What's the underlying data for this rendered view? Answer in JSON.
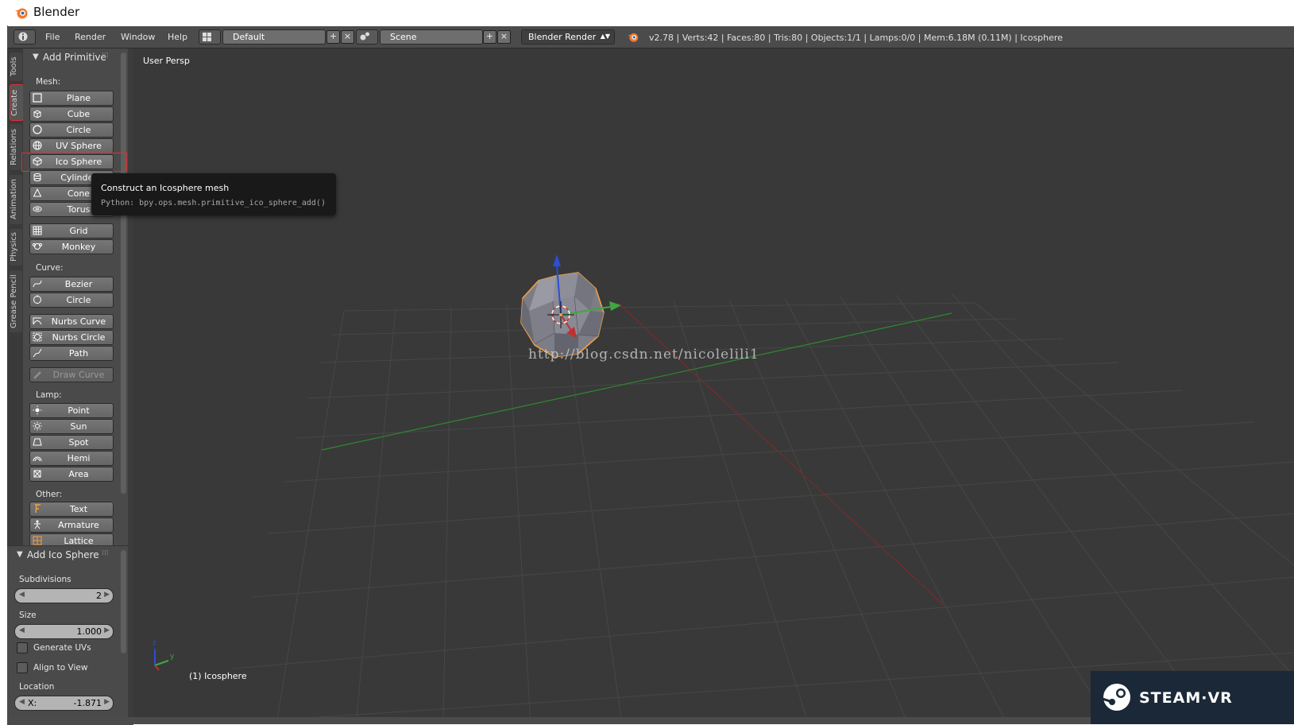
{
  "window": {
    "title": "Blender"
  },
  "menu": {
    "items": [
      "File",
      "Render",
      "Window",
      "Help"
    ]
  },
  "layout_field": "Default",
  "scene_field": "Scene",
  "engine": "Blender Render",
  "stats": "v2.78 | Verts:42 | Faces:80 | Tris:80 | Objects:1/1 | Lamps:0/0 | Mem:6.18M (0.11M) | Icosphere",
  "tabs": [
    "Tools",
    "Create",
    "Relations",
    "Animation",
    "Physics",
    "Grease Pencil"
  ],
  "tool_panel": {
    "title": "Add Primitive",
    "mesh_label": "Mesh:",
    "mesh": [
      "Plane",
      "Cube",
      "Circle",
      "UV Sphere",
      "Ico Sphere",
      "Cylinder",
      "Cone",
      "Torus"
    ],
    "mesh2": [
      "Grid",
      "Monkey"
    ],
    "curve_label": "Curve:",
    "curve": [
      "Bezier",
      "Circle"
    ],
    "curve2": [
      "Nurbs Curve",
      "Nurbs Circle",
      "Path"
    ],
    "draw_curve": "Draw Curve",
    "lamp_label": "Lamp:",
    "lamp": [
      "Point",
      "Sun",
      "Spot",
      "Hemi",
      "Area"
    ],
    "other_label": "Other:",
    "other": [
      "Text",
      "Armature",
      "Lattice"
    ]
  },
  "redo_panel": {
    "title": "Add Ico Sphere",
    "subdivisions_label": "Subdivisions",
    "subdivisions": "2",
    "size_label": "Size",
    "size": "1.000",
    "generate_uvs": "Generate UVs",
    "align_to_view": "Align to View",
    "location_label": "Location",
    "x_label": "X:",
    "x_value": "-1.871"
  },
  "tooltip": {
    "title": "Construct an Icosphere mesh",
    "python": "Python: bpy.ops.mesh.primitive_ico_sphere_add()"
  },
  "viewport": {
    "view_name": "User Persp",
    "object_name": "(1) Icosphere",
    "watermark": "http://blog.csdn.net/nicolelili1",
    "axis_y": "y",
    "axis_z": "z"
  },
  "steamvr": "STEAM·VR",
  "colors": {
    "accent": "#e03030",
    "selection": "#f0a040",
    "x_axis": "#c03030",
    "y_axis": "#3ea83e",
    "z_axis": "#2b4dd8"
  }
}
